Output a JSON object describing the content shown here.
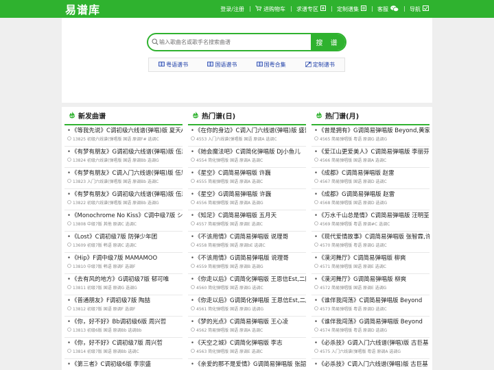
{
  "header": {
    "logo": "易谱库",
    "nav": [
      {
        "label": "登录/注册",
        "icon": "user-icon"
      },
      {
        "label": "进购物车",
        "icon": "cart-icon"
      },
      {
        "label": "求谱专区",
        "icon": "request-icon"
      },
      {
        "label": "定制谱集",
        "icon": "custom-icon"
      },
      {
        "label": "客服",
        "icon": "wechat-icon"
      },
      {
        "label": "导航",
        "icon": "nav-icon"
      }
    ]
  },
  "search": {
    "placeholder": "输入歌曲名或歌手名搜索曲谱",
    "button": "搜 谱"
  },
  "quick_links": [
    {
      "label": "粤语谱书"
    },
    {
      "label": "国语谱书"
    },
    {
      "label": "国粤合集"
    },
    {
      "label": "定制谱书"
    }
  ],
  "columns": [
    {
      "title": "新发曲谱",
      "items": [
        {
          "title": "《等我先说》C调初级六线谱(弹唱)版 夏天Alex",
          "meta": "13825 初级六线谱(弹唱版 国语 原调F# 选调C"
        },
        {
          "title": "《有梦有朋友》G调初级六线谱(弹唱)版 伍思凯",
          "meta": "13824 初级六线谱(弹唱版 国语 原调Bb 选调G"
        },
        {
          "title": "《有梦有朋友》C调入门六线谱(弹唱)版 伍思凯",
          "meta": "13823 入门六线谱(弹唱版 国语 原调Bb 选调C"
        },
        {
          "title": "《有梦有朋友》G调初级六线谱(弹唱)版 伍思凯",
          "meta": "13822 初级六线谱(弹唱版 国语 原调Bb 选调G"
        },
        {
          "title": "《Monochrome No Kiss》C调中级7版 シド",
          "meta": "13808 中级7版 其他 原调C 选调C"
        },
        {
          "title": "《Lost》C调初级7版 防弹少年团",
          "meta": "13609 初级7版 韩语 原调C 选调C"
        },
        {
          "title": "《Hip》F调中级7版 MAMAMOO",
          "meta": "13810 中级7版 韩语 原调F 选调F"
        },
        {
          "title": "《去有风的地方》G调初级7版 郁可唯",
          "meta": "13811 初级7版 国语 原调G 选调G"
        },
        {
          "title": "《普通朋友》F调初级7版 陶喆",
          "meta": "13812 初级7版 国语 原调F 选调F"
        },
        {
          "title": "《你，好不好》Bb调初级6版 周兴哲",
          "meta": "13813 初级6版 国语 原调Bb 选调Bb"
        },
        {
          "title": "《你，好不好》C调初级7版 周兴哲",
          "meta": "13814 初级7版 国语 原调Bb 选调C"
        },
        {
          "title": "《第三者》C调初级6版 李宗盛",
          "meta": ""
        }
      ]
    },
    {
      "title": "热门谱(日)",
      "items": [
        {
          "title": "《在你的身边》C调入门六线谱(弹唱)版 盛哲",
          "meta": "4553 入门六线谱(弹唱版 国语 原调A 选调C"
        },
        {
          "title": "《她会魔法吧》C调简化弹唱版 DJ小鱼儿",
          "meta": "4554 简化弹唱版 国语 原调A 选调C"
        },
        {
          "title": "《星空》C调简易弹唱版 许巍",
          "meta": "4555 简易弹唱版 国语 原调A 选调C"
        },
        {
          "title": "《星空》G调简易弹唱版 许巍",
          "meta": "4556 简易弹唱版 国语 原调A 选调G"
        },
        {
          "title": "《知足》C调简易弹唱版 五月天",
          "meta": "4557 简易弹唱版 国语 原调E 选调C"
        },
        {
          "title": "《不该用情》C调简易弹唱版 说理哥",
          "meta": "4558 简易弹唱版 国语 原调bE 选调C"
        },
        {
          "title": "《不该用情》G调简易弹唱版 说理哥",
          "meta": "4559 简易弹唱版 国语 原调B 选调G"
        },
        {
          "title": "《你走以后》C调简化弹唱版 王恩信Est,二胖u",
          "meta": "4560 简化弹唱版 国语 原调G 选调C"
        },
        {
          "title": "《你走以后》G调简化弹唱版 王恩信Est,二胖u",
          "meta": "4561 简化弹唱版 国语 原调G 选调G"
        },
        {
          "title": "《梦的光点》C调简易弹唱版 王心凌",
          "meta": "4562 简易弹唱版 国语 原调A 选调C"
        },
        {
          "title": "《天空之城》C调简化弹唱版 李志",
          "meta": "4563 简化弹唱版 国语 原调E 选调C"
        },
        {
          "title": "《亲爱的那不是爱情》G调简易弹唱版 张韶涵",
          "meta": ""
        }
      ]
    },
    {
      "title": "热门谱(月)",
      "items": [
        {
          "title": "《曾是拥有》G调简易弹唱版 Beyond,黄家驹",
          "meta": "4565 简易弹唱版 粤语 原调G 选调G"
        },
        {
          "title": "《爱江山更爱美人》C调简易弹唱版 李丽芬",
          "meta": "4566 简易弹唱版 国语 原调A 选调C"
        },
        {
          "title": "《成都》C调简易弹唱版 赵雷",
          "meta": "4567 简易弹唱版 国语 原调D 选调C"
        },
        {
          "title": "《成都》G调简易弹唱版 赵雷",
          "meta": "4568 简易弹唱版 国语 原调D 选调G"
        },
        {
          "title": "《万水千山总是情》C调简易弹唱版 汪明荃",
          "meta": "4569 简易弹唱版 粤语 原调#C 选调C"
        },
        {
          "title": "《现代爱情故事》C调简易弹唱版 张智霖,许...",
          "meta": "4570 简易弹唱版 粤语 原调G 选调C"
        },
        {
          "title": "《漠河舞厅》C调简易弹唱版 柳爽",
          "meta": "4571 简易弹唱版 国语 原调E 选调C"
        },
        {
          "title": "《漠河舞厅》G调简易弹唱版 柳爽",
          "meta": "4572 简易弹唱版 国语 原调E 选调G"
        },
        {
          "title": "《谁伴我闯荡》C调简易弹唱版 Beyond",
          "meta": "4573 简易弹唱版 粤语 原调D 选调C"
        },
        {
          "title": "《谁伴我闯荡》G调简易弹唱版 Beyond",
          "meta": "4574 简易弹唱版 粤语 原调D 选调G"
        },
        {
          "title": "《必杀技》G调入门六线谱(弹唱)版 古巨基",
          "meta": "4575 入门六线谱(弹唱版 粤语 原调A 选调G"
        },
        {
          "title": "《必杀技》C调入门六线谱(弹唱)版 古巨基",
          "meta": ""
        }
      ]
    }
  ],
  "colors": {
    "brand": "#2fb22f",
    "link": "#1e3fa8"
  }
}
